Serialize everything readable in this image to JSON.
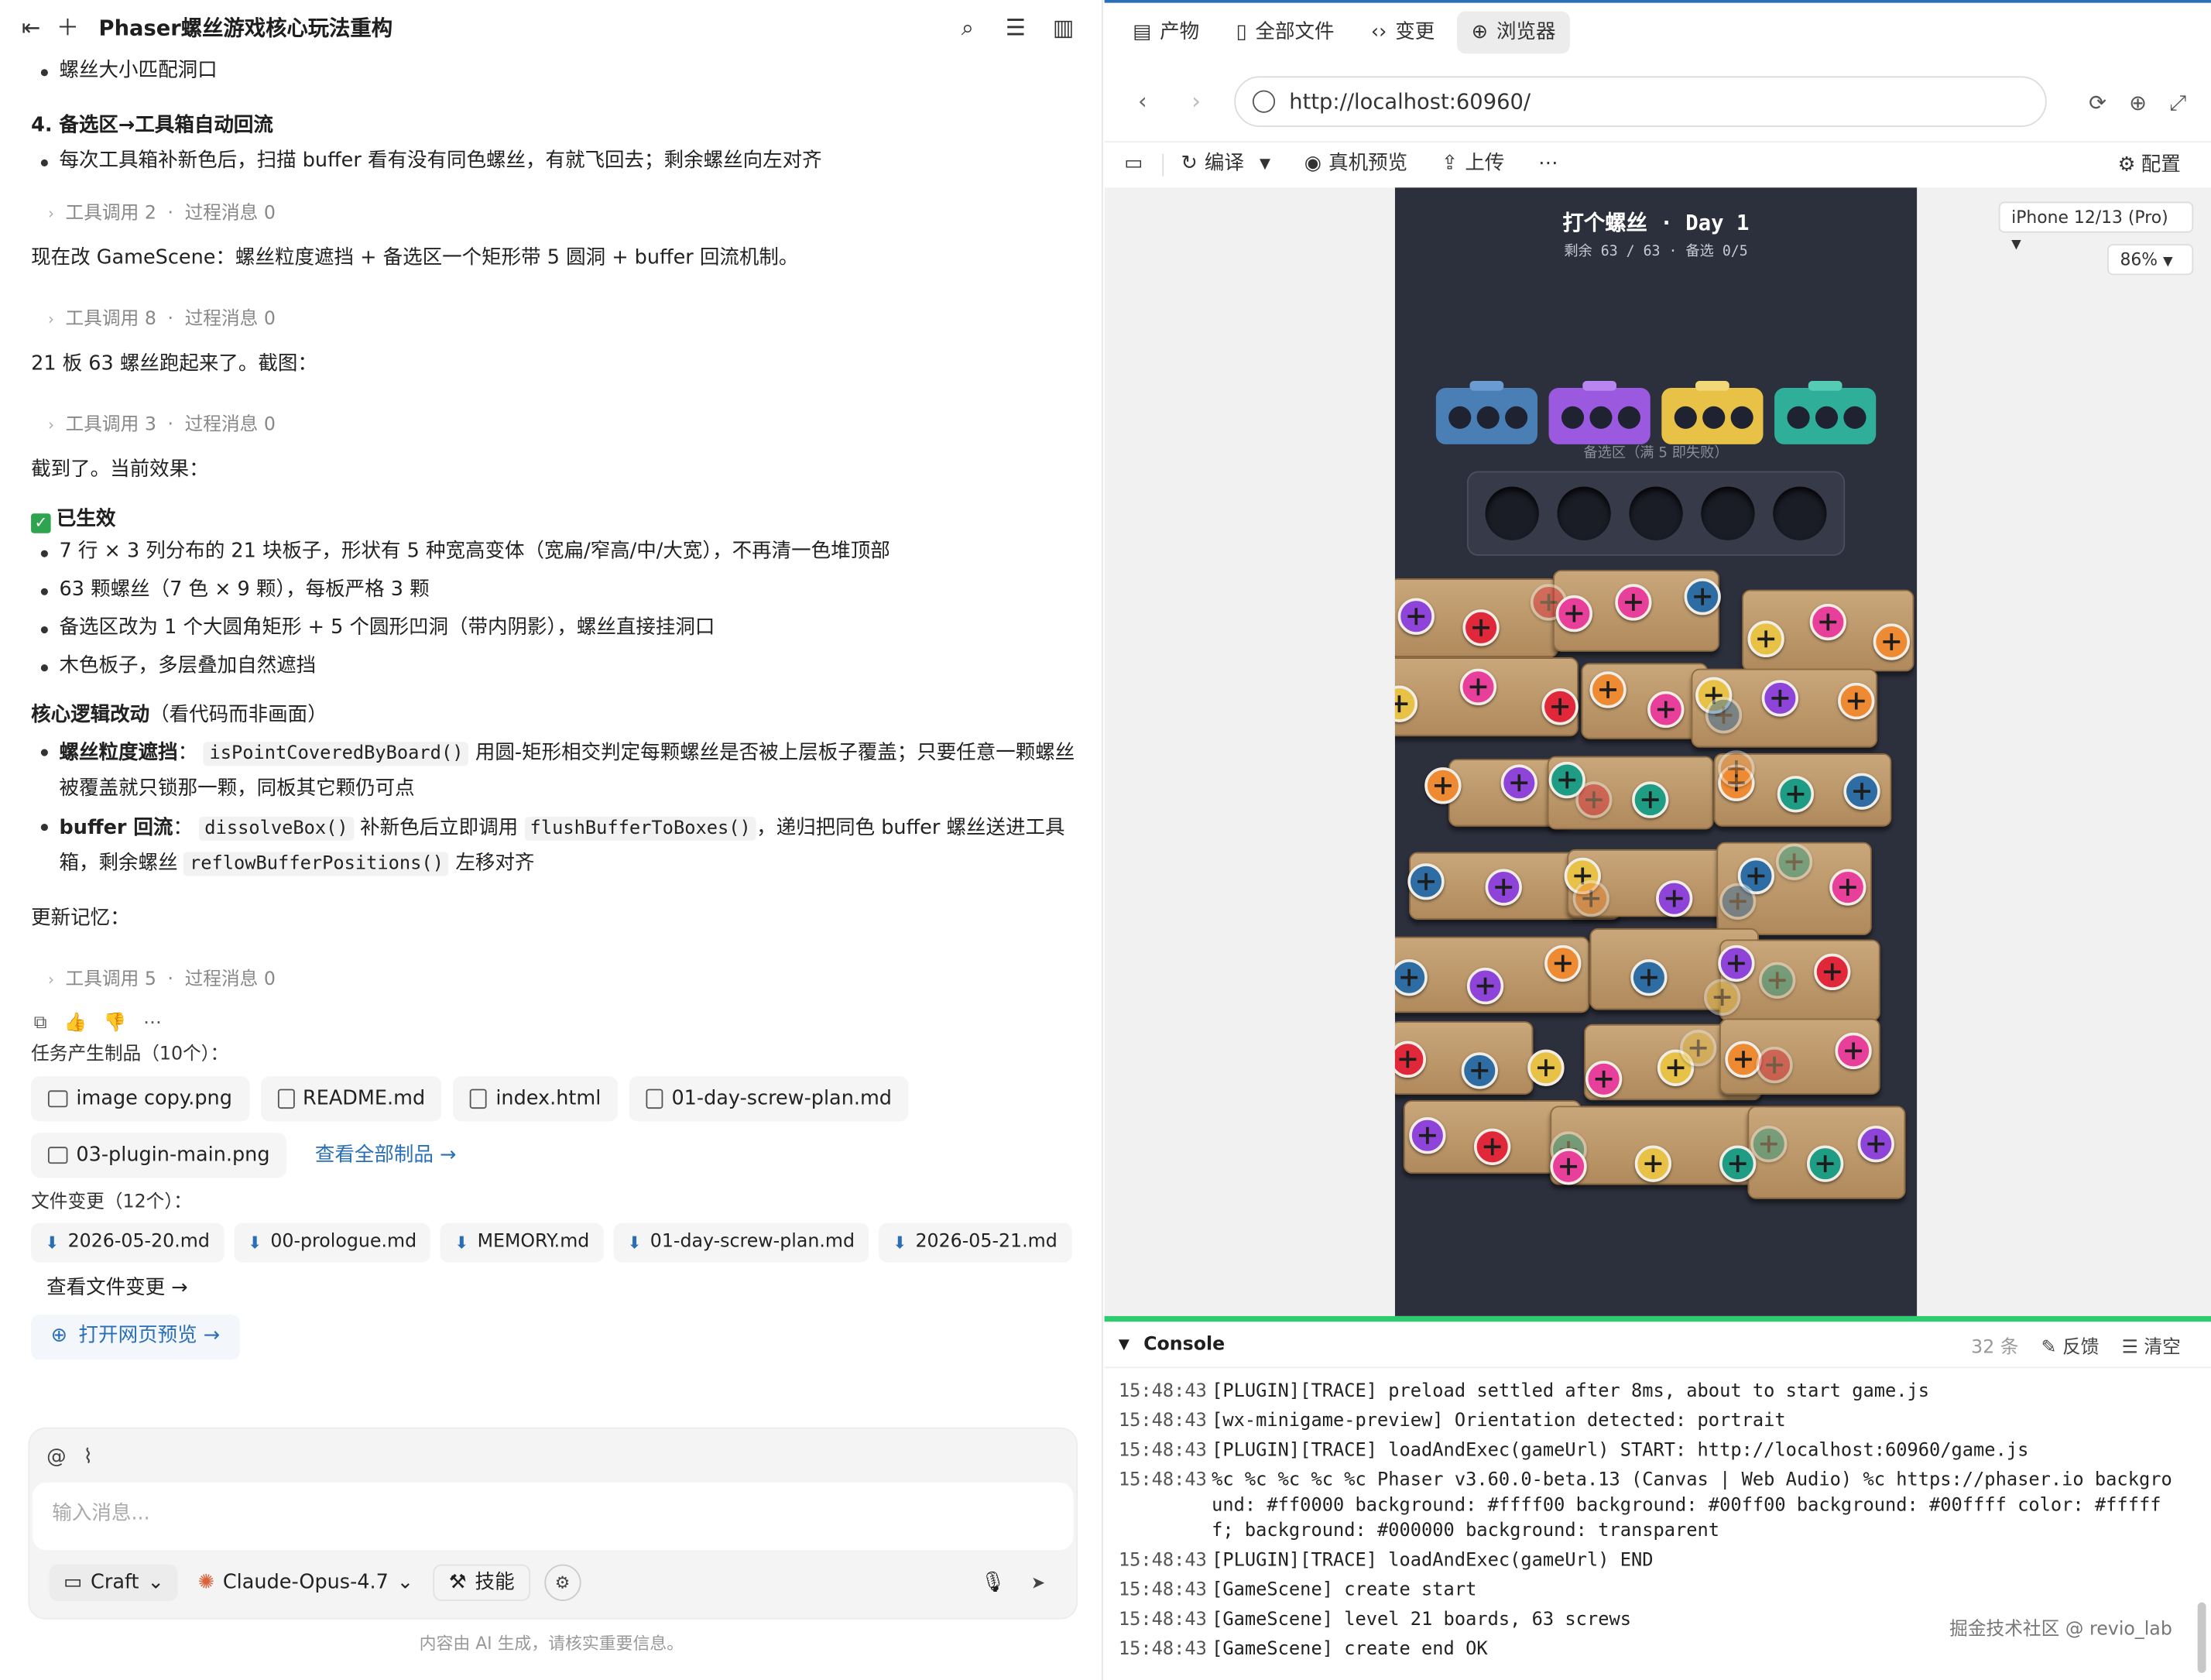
{
  "chat": {
    "title": "Phaser螺丝游戏核心玩法重构",
    "line_top": "螺丝大小匹配洞口",
    "section4_title": "4. 备选区→工具箱自动回流",
    "section4_item": "每次工具箱补新色后，扫描 buffer 看有没有同色螺丝，有就飞回去；剩余螺丝向左对齐",
    "tool_calls": [
      {
        "label": "工具调用 2",
        "sep": "·",
        "process": "过程消息 0"
      },
      {
        "label": "工具调用 8",
        "sep": "·",
        "process": "过程消息 0"
      },
      {
        "label": "工具调用 3",
        "sep": "·",
        "process": "过程消息 0"
      },
      {
        "label": "工具调用 5",
        "sep": "·",
        "process": "过程消息 0"
      }
    ],
    "msg1": "现在改 GameScene：螺丝粒度遮挡 + 备选区一个矩形带 5 圆洞 + buffer 回流机制。",
    "msg2": "21 板 63 螺丝跑起来了。截图：",
    "msg3": "截到了。当前效果：",
    "effect_title": "已生效",
    "effect_items": [
      "7 行 × 3 列分布的 21 块板子，形状有 5 种宽高变体（宽扁/窄高/中/大宽），不再清一色堆顶部",
      "63 颗螺丝（7 色 × 9 颗），每板严格 3 颗",
      "备选区改为 1 个大圆角矩形 + 5 个圆形凹洞（带内阴影），螺丝直接挂洞口",
      "木色板子，多层叠加自然遮挡"
    ],
    "core_title": "核心逻辑改动",
    "core_note": "（看代码而非画面）",
    "core1_label": "螺丝粒度遮挡",
    "core1_code": "isPointCoveredByBoard()",
    "core1_text": "用圆-矩形相交判定每颗螺丝是否被上层板子覆盖；只要任意一颗螺丝被覆盖就只锁那一颗，同板其它颗仍可点",
    "core2_label": "buffer 回流",
    "core2_code1": "dissolveBox()",
    "core2_text1": "补新色后立即调用",
    "core2_code2": "flushBufferToBoxes()",
    "core2_text2": "，递归把同色 buffer 螺丝送进工具箱，剩余螺丝",
    "core2_code3": "reflowBufferPositions()",
    "core2_text3": "左移对齐",
    "memory": "更新记忆：",
    "artifacts_title": "任务产生制品（10个）：",
    "artifacts": [
      "image copy.png",
      "README.md",
      "index.html",
      "01-day-screw-plan.md",
      "03-plugin-main.png"
    ],
    "view_all_artifacts": "查看全部制品 →",
    "changes_title": "文件变更（12个）：",
    "changes": [
      "2026-05-20.md",
      "00-prologue.md",
      "MEMORY.md",
      "01-day-screw-plan.md",
      "2026-05-21.md"
    ],
    "view_changes": "查看文件变更 →",
    "open_preview": "打开网页预览 →"
  },
  "composer": {
    "placeholder": "输入消息...",
    "mode": "Craft",
    "model": "Claude-Opus-4.7",
    "skills": "技能",
    "disclaimer": "内容由 AI 生成，请核实重要信息。"
  },
  "browser": {
    "tabs": [
      "产物",
      "全部文件",
      "变更",
      "浏览器"
    ],
    "url": "http://localhost:60960/",
    "toolbar": {
      "compile": "编译",
      "preview": "真机预览",
      "upload": "上传",
      "config": "配置"
    },
    "device": "iPhone 12/13 (Pro)",
    "zoom": "86%"
  },
  "game": {
    "title": "打个螺丝 · Day 1",
    "subtitle": "剩余 63 / 63 · 备选 0/5",
    "buffer_label": "备选区（满 5 即失败）",
    "box_colors": [
      "#4a7fb5",
      "#9b59e0",
      "#e8c147",
      "#2fae99"
    ],
    "screw_colors": {
      "purple": "#8e44d9",
      "red": "#e0283a",
      "pink": "#e8409a",
      "blue": "#2e6da4",
      "yellow": "#e8c147",
      "orange": "#ee8a32",
      "teal": "#1f9c84"
    }
  },
  "console": {
    "title": "Console",
    "count": "32 条",
    "feedback": "反馈",
    "clear": "清空",
    "logs": [
      {
        "t": "15:48:43",
        "m": "[PLUGIN][TRACE] preload settled after 8ms, about to start game.js"
      },
      {
        "t": "15:48:43",
        "m": "[wx-minigame-preview] Orientation detected: portrait"
      },
      {
        "t": "15:48:43",
        "m": "[PLUGIN][TRACE] loadAndExec(gameUrl) START: http://localhost:60960/game.js"
      },
      {
        "t": "15:48:43",
        "m": "%c %c %c %c %c Phaser v3.60.0-beta.13 (Canvas | Web Audio) %c https://phaser.io background: #ff0000 background: #ffff00 background: #00ff00 background: #00ffff color: #ffffff; background: #000000 background: transparent"
      },
      {
        "t": "15:48:43",
        "m": "[PLUGIN][TRACE] loadAndExec(gameUrl) END"
      },
      {
        "t": "15:48:43",
        "m": "[GameScene] create start"
      },
      {
        "t": "15:48:43",
        "m": "[GameScene] level 21 boards, 63 screws"
      },
      {
        "t": "15:48:43",
        "m": "[GameScene] create end OK"
      }
    ],
    "watermark": "掘金技术社区 @ revio_lab"
  }
}
